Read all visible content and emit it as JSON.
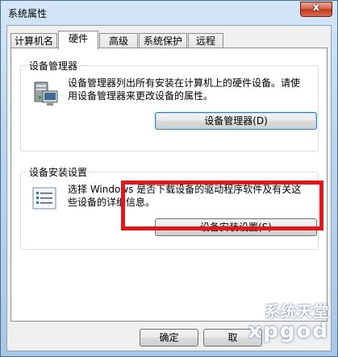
{
  "window": {
    "title": "系统属性",
    "close_symbol": "x"
  },
  "tabs": [
    {
      "label": "计算机名"
    },
    {
      "label": "硬件"
    },
    {
      "label": "高级"
    },
    {
      "label": "系统保护"
    },
    {
      "label": "远程"
    }
  ],
  "active_tab": "硬件",
  "device_manager": {
    "group_title": "设备管理器",
    "description_line1": "设备管理器列出所有安装在计算机上的硬件设备。请使",
    "description_line2": "用设备管理器来更改设备的属性。",
    "button_label": "设备管理器(D)",
    "icon": "computer-device-manager-icon"
  },
  "device_install": {
    "group_title": "设备安装设置",
    "description_line1": "选择 Windows 是否下载设备的驱动程序软件及有关这",
    "description_line2": "些设备的详细信息。",
    "button_label": "设备安装设置(S)",
    "icon": "checklist-icon"
  },
  "footer": {
    "ok_label": "确定",
    "cancel_label": "取"
  },
  "watermark": {
    "cn": "系统天堂",
    "en": "xpgod"
  },
  "colors": {
    "highlight": "#e2171c",
    "focus": "#3c7fb1"
  }
}
